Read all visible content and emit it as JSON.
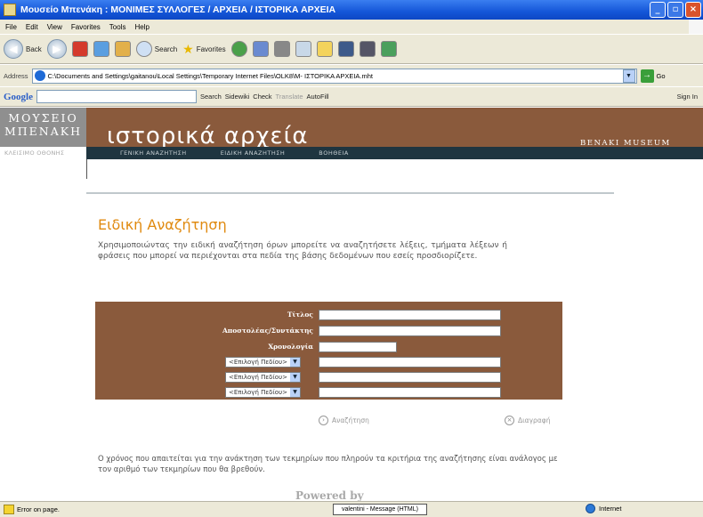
{
  "window": {
    "title": "Μουσείο Μπενάκη : ΜΟΝΙΜΕΣ ΣΥΛΛΟΓΕΣ / ΑΡΧΕΙΑ / ΙΣΤΟΡΙΚΑ ΑΡΧΕΙΑ",
    "buttons": [
      "_",
      "▫",
      "×"
    ]
  },
  "menu": [
    "File",
    "Edit",
    "View",
    "Favorites",
    "Tools",
    "Help"
  ],
  "toolbar": {
    "back": "Back",
    "search": "Search",
    "favorites": "Favorites"
  },
  "address": {
    "label": "Address",
    "value": "C:\\Documents and Settings\\gaitanou\\Local Settings\\Temporary Internet Files\\OLK8\\M- ΙΣΤΟΡΙΚΑ ΑΡΧΕΙΑ.mht",
    "go": "Go"
  },
  "google": {
    "logo": "Google",
    "search": "Search",
    "sidewiki": "Sidewiki",
    "check": "Check",
    "translate": "Translate",
    "autofill": "AutoFill",
    "signin": "Sign In"
  },
  "site": {
    "logo_line1": "ΜΟΥΣΕΙΟ",
    "logo_line2": "ΜΠΕΝΑΚΗ",
    "header_title": "ιστορικά αρχεία",
    "benaki": "BENAKI MUSEUM",
    "fullscreen": "ΚΛΕΙΣΙΜΟ ΟΘΟΝΗΣ",
    "nav": [
      "ΓΕΝΙΚΗ ΑΝΑΖΗΤΗΣΗ",
      "ΕΙΔΙΚΗ ΑΝΑΖΗΤΗΣΗ",
      "ΒΟΗΘΕΙΑ"
    ],
    "heading": "Ειδική Αναζήτηση",
    "intro": "Χρησιμοποιώντας την ειδική αναζήτηση όρων μπορείτε να αναζητήσετε λέξεις, τμήματα λέξεων ή φράσεις που μπορεί να περιέχονται στα πεδία της βάσης δεδομένων που εσείς προσδιορίζετε.",
    "form": {
      "title_label": "Τίτλος",
      "sender_label": "Αποστολέας/Συντάκτης",
      "date_label": "Χρονολογία",
      "field_select": "<Επιλογή Πεδίου>"
    },
    "search_btn": "Αναζήτηση",
    "clear_btn": "Διαγραφή",
    "note": "Ο χρόνος που απαιτείται για την ανάκτηση των τεκμηρίων που πληρούν τα κριτήρια της αναζήτησης είναι ανάλογος με τον αριθμό των τεκμηρίων που θα βρεθούν.",
    "powered": "Powered by"
  },
  "status": {
    "left": "Error on page.",
    "tooltip": "valentini - Message (HTML)",
    "zone": "Internet"
  }
}
